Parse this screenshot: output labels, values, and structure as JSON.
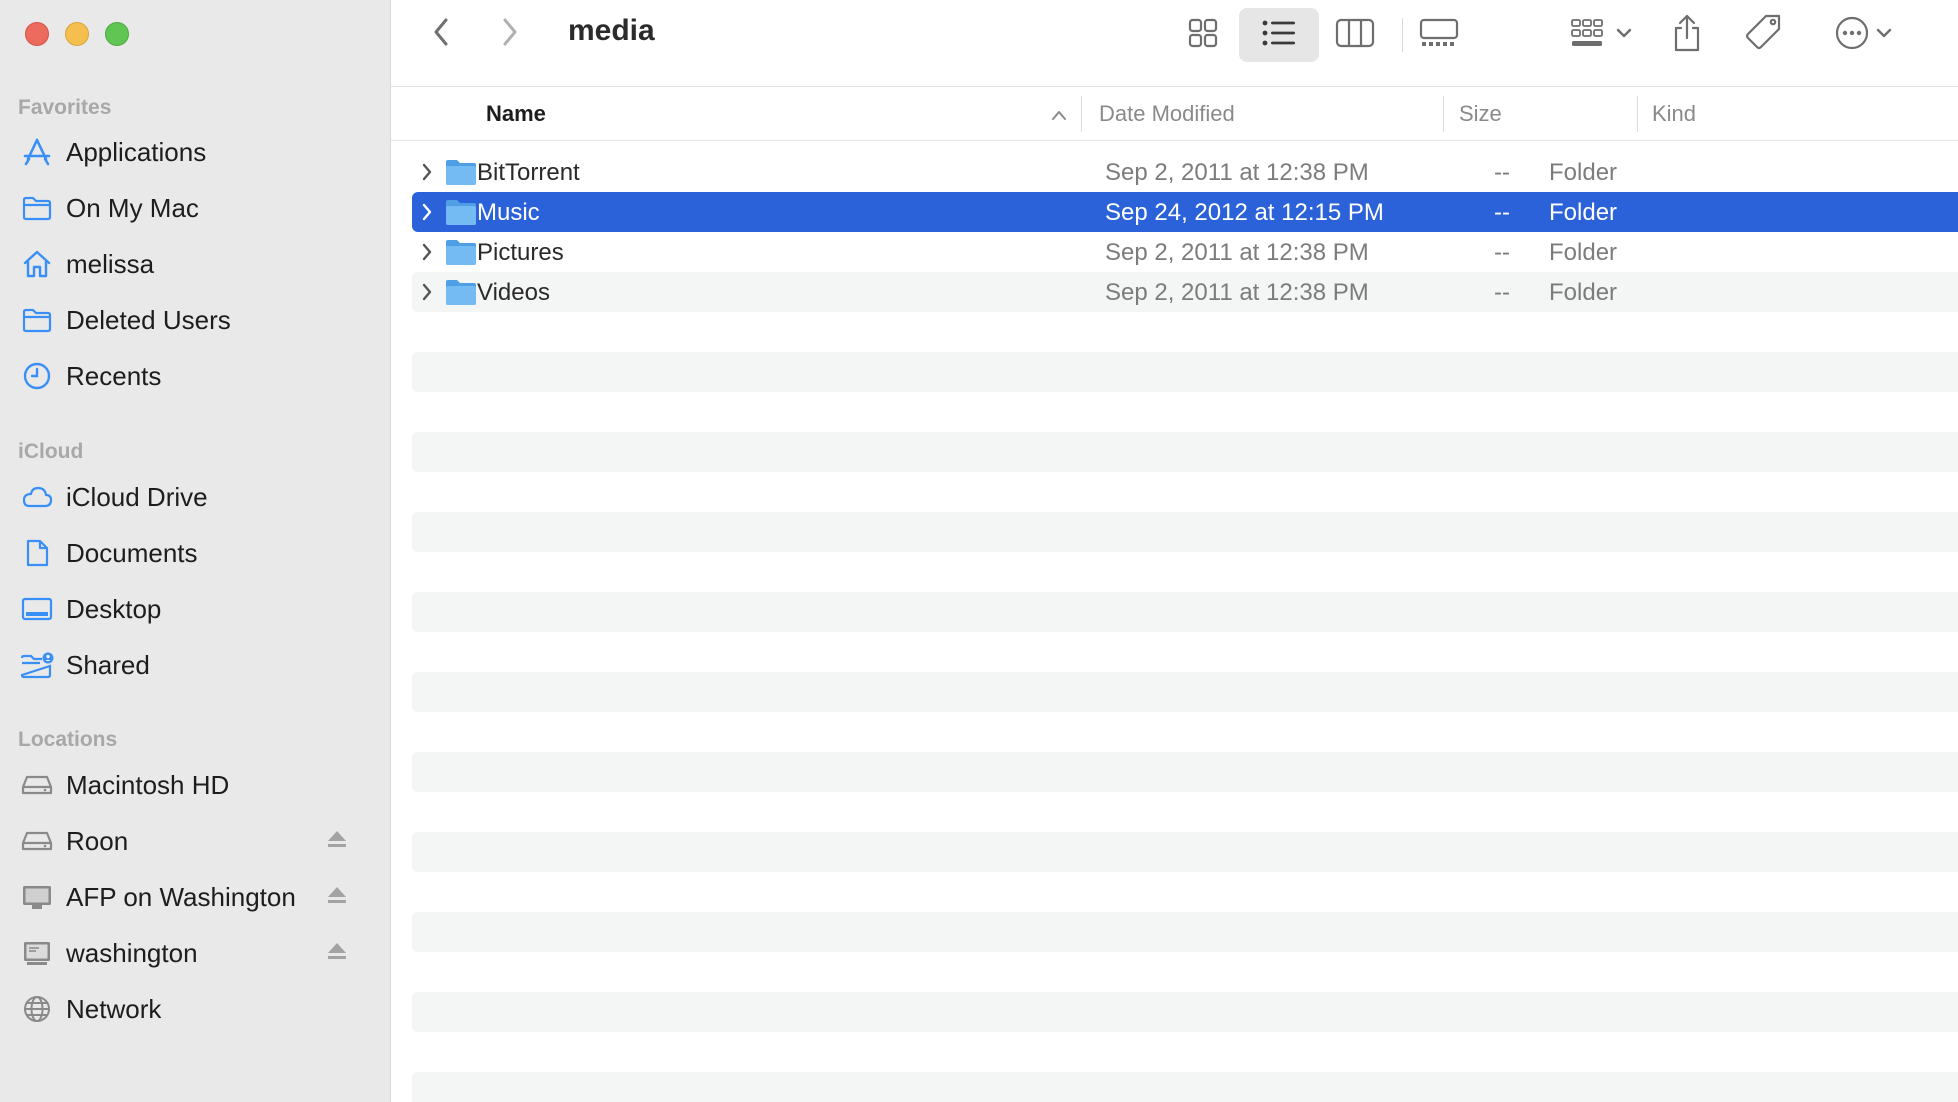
{
  "window": {
    "title": "media"
  },
  "sidebar": {
    "sections": [
      {
        "title": "Favorites",
        "items": [
          {
            "label": "Applications",
            "icon": "applications-icon"
          },
          {
            "label": "On My Mac",
            "icon": "folder-icon"
          },
          {
            "label": "melissa",
            "icon": "home-icon"
          },
          {
            "label": "Deleted Users",
            "icon": "folder-icon"
          },
          {
            "label": "Recents",
            "icon": "clock-icon"
          }
        ]
      },
      {
        "title": "iCloud",
        "items": [
          {
            "label": "iCloud Drive",
            "icon": "cloud-icon"
          },
          {
            "label": "Documents",
            "icon": "document-icon"
          },
          {
            "label": "Desktop",
            "icon": "desktop-icon"
          },
          {
            "label": "Shared",
            "icon": "shared-folder-icon"
          }
        ]
      },
      {
        "title": "Locations",
        "items": [
          {
            "label": "Macintosh HD",
            "icon": "drive-icon"
          },
          {
            "label": "Roon",
            "icon": "drive-icon",
            "eject": true
          },
          {
            "label": "AFP on Washington",
            "icon": "display-icon",
            "eject": true
          },
          {
            "label": "washington",
            "icon": "server-icon",
            "eject": true
          },
          {
            "label": "Network",
            "icon": "globe-icon"
          }
        ]
      }
    ]
  },
  "columns": {
    "name": "Name",
    "date": "Date Modified",
    "size": "Size",
    "kind": "Kind"
  },
  "files": [
    {
      "name": "BitTorrent",
      "date": "Sep 2, 2011 at 12:38 PM",
      "size": "--",
      "kind": "Folder",
      "selected": false
    },
    {
      "name": "Music",
      "date": "Sep 24, 2012 at 12:15 PM",
      "size": "--",
      "kind": "Folder",
      "selected": true
    },
    {
      "name": "Pictures",
      "date": "Sep 2, 2011 at 12:38 PM",
      "size": "--",
      "kind": "Folder",
      "selected": false
    },
    {
      "name": "Videos",
      "date": "Sep 2, 2011 at 12:38 PM",
      "size": "--",
      "kind": "Folder",
      "selected": false
    }
  ],
  "colors": {
    "accent": "#2b62d9",
    "sidebar_icon": "#3a8ff7",
    "folder": "#67b4f1",
    "close": "#ec6a5e",
    "minimize": "#f4bf4f",
    "zoom": "#61c554"
  }
}
